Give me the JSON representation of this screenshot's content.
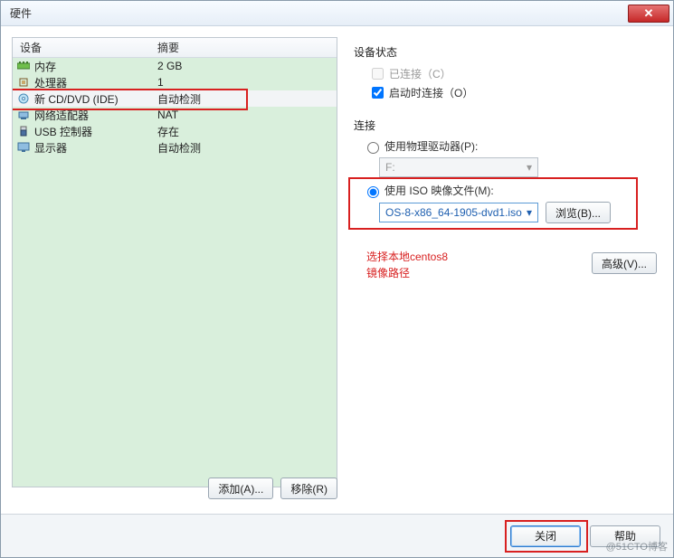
{
  "window": {
    "title": "硬件"
  },
  "list": {
    "col_device": "设备",
    "col_summary": "摘要",
    "rows": [
      {
        "name": "内存",
        "summary": "2 GB",
        "icon": "memory"
      },
      {
        "name": "处理器",
        "summary": "1",
        "icon": "cpu"
      },
      {
        "name": "新 CD/DVD (IDE)",
        "summary": "自动检测",
        "icon": "disc",
        "selected": true
      },
      {
        "name": "网络适配器",
        "summary": "NAT",
        "icon": "net"
      },
      {
        "name": "USB 控制器",
        "summary": "存在",
        "icon": "usb"
      },
      {
        "name": "显示器",
        "summary": "自动检测",
        "icon": "display"
      }
    ]
  },
  "right": {
    "status_title": "设备状态",
    "connected_label": "已连接（C）",
    "on_power_label": "启动时连接（O）",
    "on_power_checked": true,
    "connect_title": "连接",
    "use_physical_label": "使用物理驱动器(P):",
    "physical_drive": "F:",
    "use_iso_label": "使用 ISO 映像文件(M):",
    "iso_value": "OS-8-x86_64-1905-dvd1.iso",
    "browse_label": "浏览(B)...",
    "advanced_label": "高级(V)..."
  },
  "annotation": {
    "line1": "选择本地centos8",
    "line2": "镜像路径"
  },
  "buttons": {
    "add": "添加(A)...",
    "remove": "移除(R)",
    "close": "关闭",
    "help": "帮助"
  },
  "watermark": "@51CTO博客"
}
